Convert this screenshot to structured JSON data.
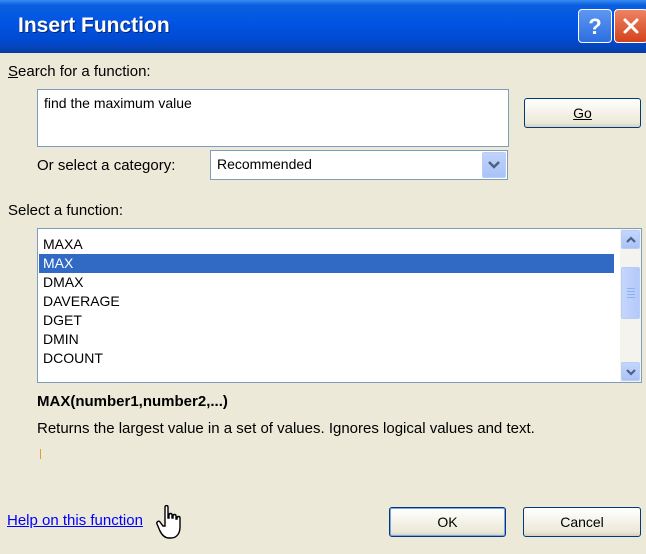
{
  "window": {
    "title": "Insert Function"
  },
  "search": {
    "label": "Search for a function:",
    "value": "find the maximum value",
    "go_label": "Go"
  },
  "category": {
    "label": "Or select a category:",
    "value": "Recommended"
  },
  "functions": {
    "label": "Select a function:",
    "items": [
      "MAXA",
      "MAX",
      "DMAX",
      "DAVERAGE",
      "DGET",
      "DMIN",
      "DCOUNT"
    ],
    "selected": "MAX"
  },
  "description": {
    "signature": "MAX(number1,number2,...)",
    "text": "Returns the largest value in a set of values. Ignores logical values and text."
  },
  "footer": {
    "help_link": "Help on this function",
    "ok_label": "OK",
    "cancel_label": "Cancel"
  },
  "icons": [
    "help-icon",
    "close-icon",
    "dropdown-arrow-icon",
    "scroll-up-icon",
    "scroll-down-icon",
    "hand-cursor-icon"
  ]
}
